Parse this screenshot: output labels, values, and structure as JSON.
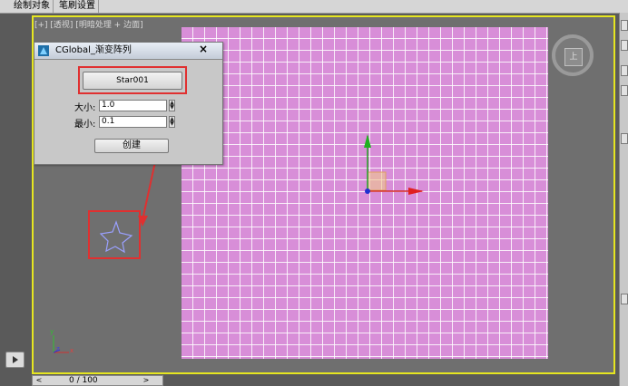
{
  "menubar": {
    "items": [
      "绘制对象",
      "笔刷设置"
    ]
  },
  "viewport": {
    "label": "[+] [透视] [明暗处理 + 边面]",
    "viewcube_label": "上",
    "axes": {
      "x": "x",
      "y": "y",
      "z": "z"
    }
  },
  "dialog": {
    "title": "CGlobal_渐变阵列",
    "close": "×",
    "object_button": "Star001",
    "size_label": "大小:",
    "size_value": "1.0",
    "min_label": "最小:",
    "min_value": "0.1",
    "create_button": "创建"
  },
  "timeline": {
    "position": "0 / 100",
    "prev": "<",
    "next": ">"
  },
  "colors": {
    "highlight_red": "#e03030",
    "viewport_border": "#e6e620",
    "grid_fill": "#d88ed8"
  }
}
